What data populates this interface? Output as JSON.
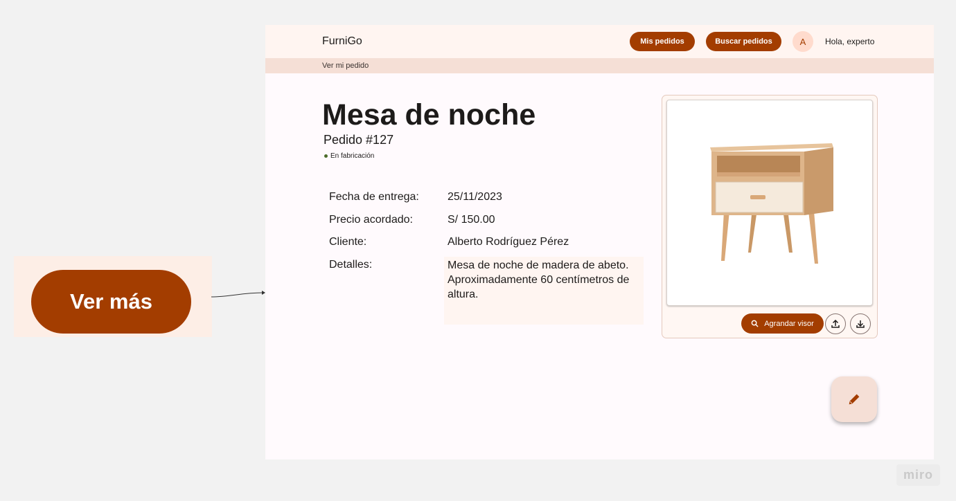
{
  "callout": {
    "button_label": "Ver más"
  },
  "header": {
    "brand": "FurniGo",
    "nav": [
      {
        "label": "Mis pedidos"
      },
      {
        "label": "Buscar pedidos"
      }
    ],
    "avatar_initial": "A",
    "greeting": "Hola, experto"
  },
  "breadcrumb": "Ver mi pedido",
  "order": {
    "title": "Mesa de noche",
    "number": "Pedido #127",
    "status": "En fabricación",
    "fields": [
      {
        "label": "Fecha de entrega:",
        "value": "25/11/2023"
      },
      {
        "label": "Precio acordado:",
        "value": "S/ 150.00"
      },
      {
        "label": "Cliente:",
        "value": "Alberto Rodríguez Pérez"
      },
      {
        "label": "Detalles:",
        "value": "Mesa de noche de madera de abeto. Aproximadamente 60 centímetros de altura."
      }
    ]
  },
  "viewer": {
    "zoom_label": "Agrandar visor",
    "upload_icon": "upload-icon",
    "download_icon": "download-icon"
  },
  "fab_icon": "pencil-icon",
  "watermark": "miro",
  "colors": {
    "primary": "#a33d00",
    "surface": "#fffafd",
    "topbar": "#fff5f1",
    "crumbbar": "#f5dfd6",
    "status_dot": "#4d6c2a"
  }
}
